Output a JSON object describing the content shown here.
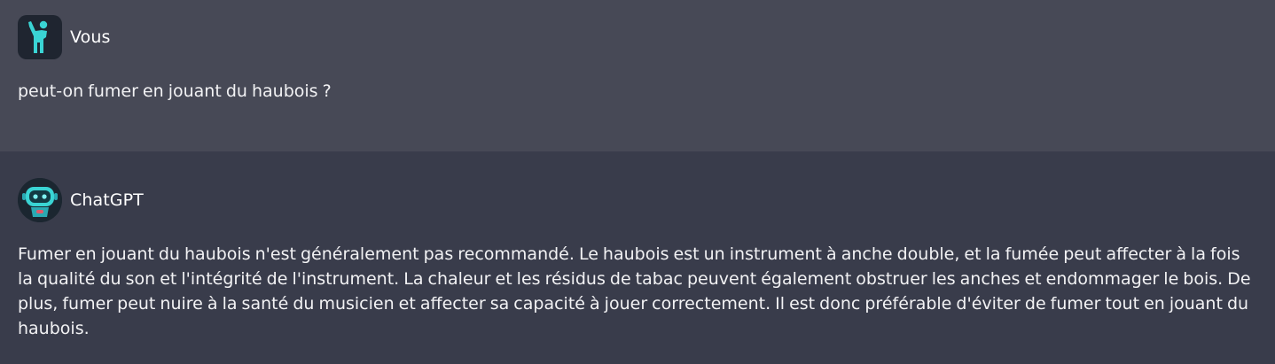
{
  "conversation": [
    {
      "role": "user",
      "author": "Vous",
      "avatar_icon": "waving-person-icon",
      "text": "peut-on fumer en jouant du haubois ?"
    },
    {
      "role": "assistant",
      "author": "ChatGPT",
      "avatar_icon": "robot-icon",
      "text": "Fumer en jouant du haubois n'est généralement pas recommandé. Le haubois est un instrument à anche double, et la fumée peut affecter à la fois la qualité du son et l'intégrité de l'instrument. La chaleur et les résidus de tabac peuvent également obstruer les anches et endommager le bois. De plus, fumer peut nuire à la santé du musicien et affecter sa capacité à jouer correctement. Il est donc préférable d'éviter de fumer tout en jouant du haubois."
    }
  ],
  "colors": {
    "user_bg": "#474956",
    "assistant_bg": "#393c4b",
    "accent": "#3ad4d4"
  }
}
